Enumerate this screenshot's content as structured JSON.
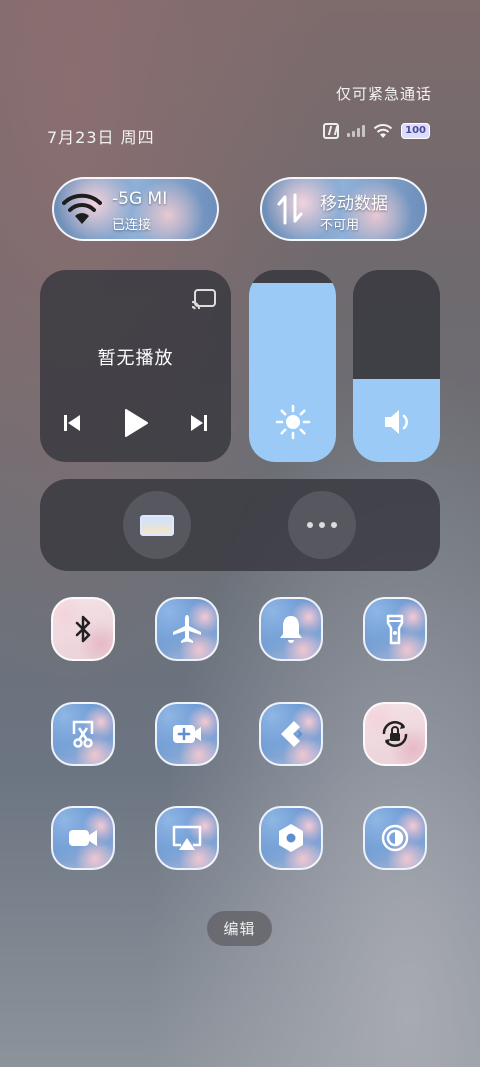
{
  "status": {
    "emergency_text": "仅可紧急通话",
    "date": "7月23日 周四",
    "battery": "100",
    "icons": [
      "nfc-icon",
      "signal-icon",
      "wifi-icon",
      "battery-icon"
    ]
  },
  "wifi": {
    "title": "-5G MI",
    "subtitle": "已连接",
    "icon": "wifi-icon",
    "active": true
  },
  "mobile_data": {
    "title": "移动数据",
    "subtitle": "不可用",
    "icon": "data-arrows-icon",
    "active": false
  },
  "media": {
    "now_playing": "暂无播放",
    "icons": [
      "cast-icon",
      "previous-icon",
      "play-icon",
      "next-icon"
    ]
  },
  "brightness": {
    "icon": "sun-icon",
    "level": 0.93
  },
  "volume": {
    "icon": "speaker-icon",
    "level": 0.43
  },
  "shortcuts": [
    {
      "icon": "display-icon"
    },
    {
      "icon": "more-icon"
    }
  ],
  "toggles": [
    {
      "icon": "bluetooth-icon",
      "active": false
    },
    {
      "icon": "airplane-icon",
      "active": true
    },
    {
      "icon": "bell-icon",
      "active": true
    },
    {
      "icon": "flashlight-icon",
      "active": true
    },
    {
      "icon": "screenshot-icon",
      "active": true
    },
    {
      "icon": "video-plus-icon",
      "active": true
    },
    {
      "icon": "nearby-share-icon",
      "active": true
    },
    {
      "icon": "rotation-lock-icon",
      "active": false
    },
    {
      "icon": "video-camera-icon",
      "active": true
    },
    {
      "icon": "screen-cast-icon",
      "active": true
    },
    {
      "icon": "settings-hex-icon",
      "active": true
    },
    {
      "icon": "reading-mode-icon",
      "active": true
    }
  ],
  "edit_label": "编辑",
  "colors": {
    "accent": "#9bcaf7",
    "card": "#37373e"
  }
}
